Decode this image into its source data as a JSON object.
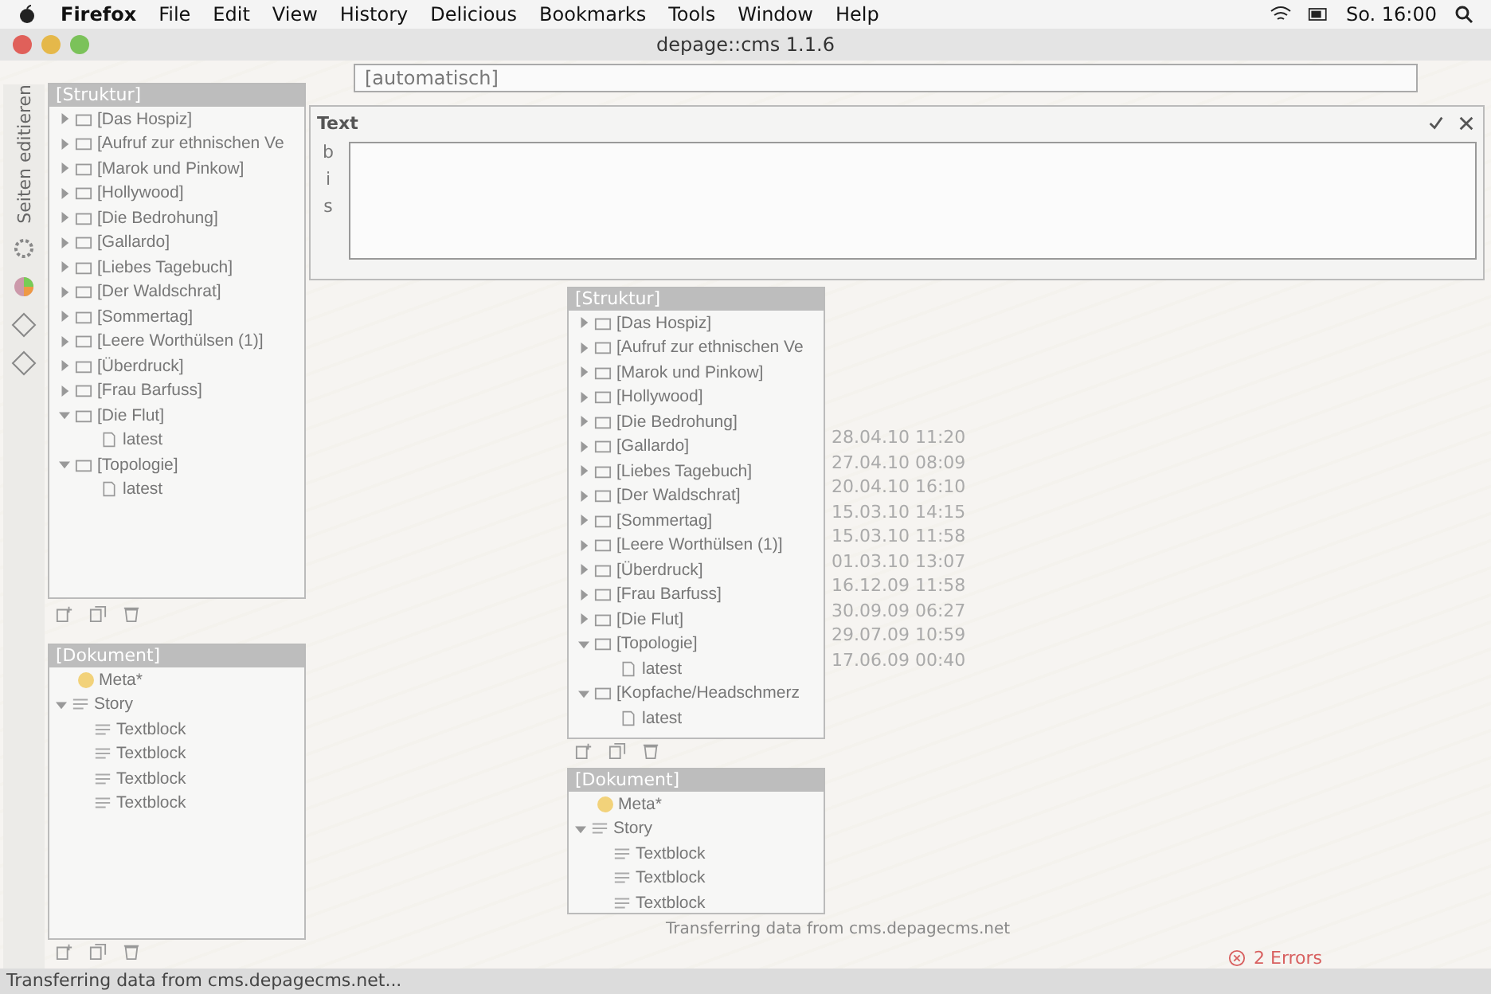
{
  "menu_bar": {
    "app": "Firefox",
    "items": [
      "File",
      "Edit",
      "View",
      "History",
      "Delicious",
      "Bookmarks",
      "Tools",
      "Window",
      "Help"
    ],
    "clock": "So. 16:00"
  },
  "window": {
    "title": "depage::cms 1.1.6",
    "address": "[automatisch]"
  },
  "side_tab": {
    "label": "Seiten editieren"
  },
  "structure_panel": {
    "title": "[Struktur]",
    "items": [
      {
        "label": "[Das Hospiz]",
        "expanded": false
      },
      {
        "label": "[Aufruf zur ethnischen Ve",
        "expanded": false
      },
      {
        "label": "[Marok und Pinkow]",
        "expanded": false
      },
      {
        "label": "[Hollywood]",
        "expanded": false
      },
      {
        "label": "[Die Bedrohung]",
        "expanded": false
      },
      {
        "label": "[Gallardo]",
        "expanded": false
      },
      {
        "label": "[Liebes Tagebuch]",
        "expanded": false
      },
      {
        "label": "[Der Waldschrat]",
        "expanded": false
      },
      {
        "label": "[Sommertag]",
        "expanded": false
      },
      {
        "label": "[Leere Worthülsen (1)]",
        "expanded": false
      },
      {
        "label": "[Überdruck]",
        "expanded": false
      },
      {
        "label": "[Frau Barfuss]",
        "expanded": false
      },
      {
        "label": "[Die Flut]",
        "expanded": true,
        "children": [
          {
            "label": "latest"
          }
        ]
      },
      {
        "label": "[Topologie]",
        "expanded": true,
        "children": [
          {
            "label": "latest"
          }
        ]
      }
    ]
  },
  "document_panel": {
    "title": "[Dokument]",
    "items": [
      {
        "kind": "meta",
        "label": "Meta*",
        "color": "#f2d27a"
      },
      {
        "kind": "story",
        "label": "Story",
        "expanded": true,
        "children": [
          {
            "label": "Textblock"
          },
          {
            "label": "Textblock"
          },
          {
            "label": "Textblock"
          },
          {
            "label": "Textblock"
          }
        ]
      }
    ]
  },
  "text_panel": {
    "title": "Text",
    "tools": [
      "b",
      "i",
      "s"
    ]
  },
  "second_structure_panel": {
    "title": "[Struktur]",
    "items": [
      {
        "label": "[Das Hospiz]",
        "expanded": false
      },
      {
        "label": "[Aufruf zur ethnischen Ve",
        "expanded": false
      },
      {
        "label": "[Marok und Pinkow]",
        "expanded": false
      },
      {
        "label": "[Hollywood]",
        "expanded": false
      },
      {
        "label": "[Die Bedrohung]",
        "expanded": false
      },
      {
        "label": "[Gallardo]",
        "expanded": false
      },
      {
        "label": "[Liebes Tagebuch]",
        "expanded": false
      },
      {
        "label": "[Der Waldschrat]",
        "expanded": false
      },
      {
        "label": "[Sommertag]",
        "expanded": false
      },
      {
        "label": "[Leere Worthülsen (1)]",
        "expanded": false
      },
      {
        "label": "[Überdruck]",
        "expanded": false
      },
      {
        "label": "[Frau Barfuss]",
        "expanded": false
      },
      {
        "label": "[Die Flut]",
        "expanded": false
      },
      {
        "label": "[Topologie]",
        "expanded": true,
        "children": [
          {
            "label": "latest"
          }
        ]
      },
      {
        "label": "[Kopfache/Headschmerz",
        "expanded": true,
        "children": [
          {
            "label": "latest"
          }
        ]
      }
    ],
    "dates": [
      "28.04.10 11:20",
      "27.04.10 08:09",
      "20.04.10 16:10",
      "15.03.10 14:15",
      "15.03.10 11:58",
      "01.03.10 13:07",
      "16.12.09 11:58",
      "30.09.09 06:27",
      "29.07.09 10:59",
      "17.06.09 00:40"
    ]
  },
  "second_document_panel": {
    "title": "[Dokument]",
    "items": [
      {
        "kind": "meta",
        "label": "Meta*",
        "color": "#f2d27a"
      },
      {
        "kind": "story",
        "label": "Story",
        "expanded": true,
        "children": [
          {
            "label": "Textblock"
          },
          {
            "label": "Textblock"
          },
          {
            "label": "Textblock"
          }
        ]
      }
    ]
  },
  "center_status": "Transferring data from cms.depagecms.net",
  "errors": "2 Errors",
  "status_bar": "Transferring data from cms.depagecms.net..."
}
